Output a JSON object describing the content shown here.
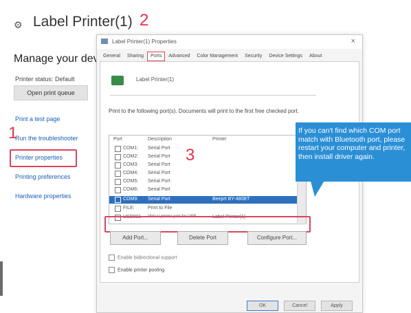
{
  "background": {
    "title": "Label Printer(1)",
    "heading": "Manage your devi",
    "status_text": "Printer status:   Default",
    "open_queue_label": "Open print queue",
    "links": [
      "Print a test page",
      "Run the troubleshooter",
      "Printer properties",
      "Printing preferences",
      "Hardware properties"
    ]
  },
  "steps": {
    "one": "1",
    "two": "2",
    "three": "3"
  },
  "dialog": {
    "title": "Label Printer(1) Properties",
    "close": "×",
    "tabs": [
      "General",
      "Sharing",
      "Ports",
      "Advanced",
      "Color Management",
      "Security",
      "Device Settings",
      "About"
    ],
    "printer_name": "Label Printer(1)",
    "description": "Print to the following port(s). Documents will print to the first free checked port.",
    "columns": {
      "port": "Port",
      "description": "Description",
      "printer": "Printer"
    },
    "ports": [
      {
        "port": "COM1:",
        "description": "Serial Port",
        "printer": ""
      },
      {
        "port": "COM2:",
        "description": "Serial Port",
        "printer": ""
      },
      {
        "port": "COM3:",
        "description": "Serial Port",
        "printer": ""
      },
      {
        "port": "COM4:",
        "description": "Serial Port",
        "printer": ""
      },
      {
        "port": "COM5:",
        "description": "Serial Port",
        "printer": ""
      },
      {
        "port": "COM6:",
        "description": "Serial Port",
        "printer": ""
      },
      {
        "port": "COM9:",
        "description": "Serial Port",
        "printer": "Beeprt BY-480BT"
      },
      {
        "port": "FILE:",
        "description": "Print to File",
        "printer": ""
      },
      {
        "port": "USB001",
        "description": "Virtual printer port for USB",
        "printer": "Label Printer(1)"
      }
    ],
    "add_port": "Add Port...",
    "delete_port": "Delete Port",
    "configure_port": "Configure Port...",
    "bidirectional": "Enable bidirectional support",
    "pooling": "Enable printer pooling",
    "ok": "OK",
    "cancel": "Cancel",
    "apply": "Apply"
  },
  "callout": {
    "text": "If you can't find which COM port match with Bluetooth port, please restart your computer and printer, then install driver again."
  },
  "colors": {
    "accent_red": "#e0334e",
    "callout_blue": "#2b8fd6",
    "selection_blue": "#2e6fbf"
  }
}
